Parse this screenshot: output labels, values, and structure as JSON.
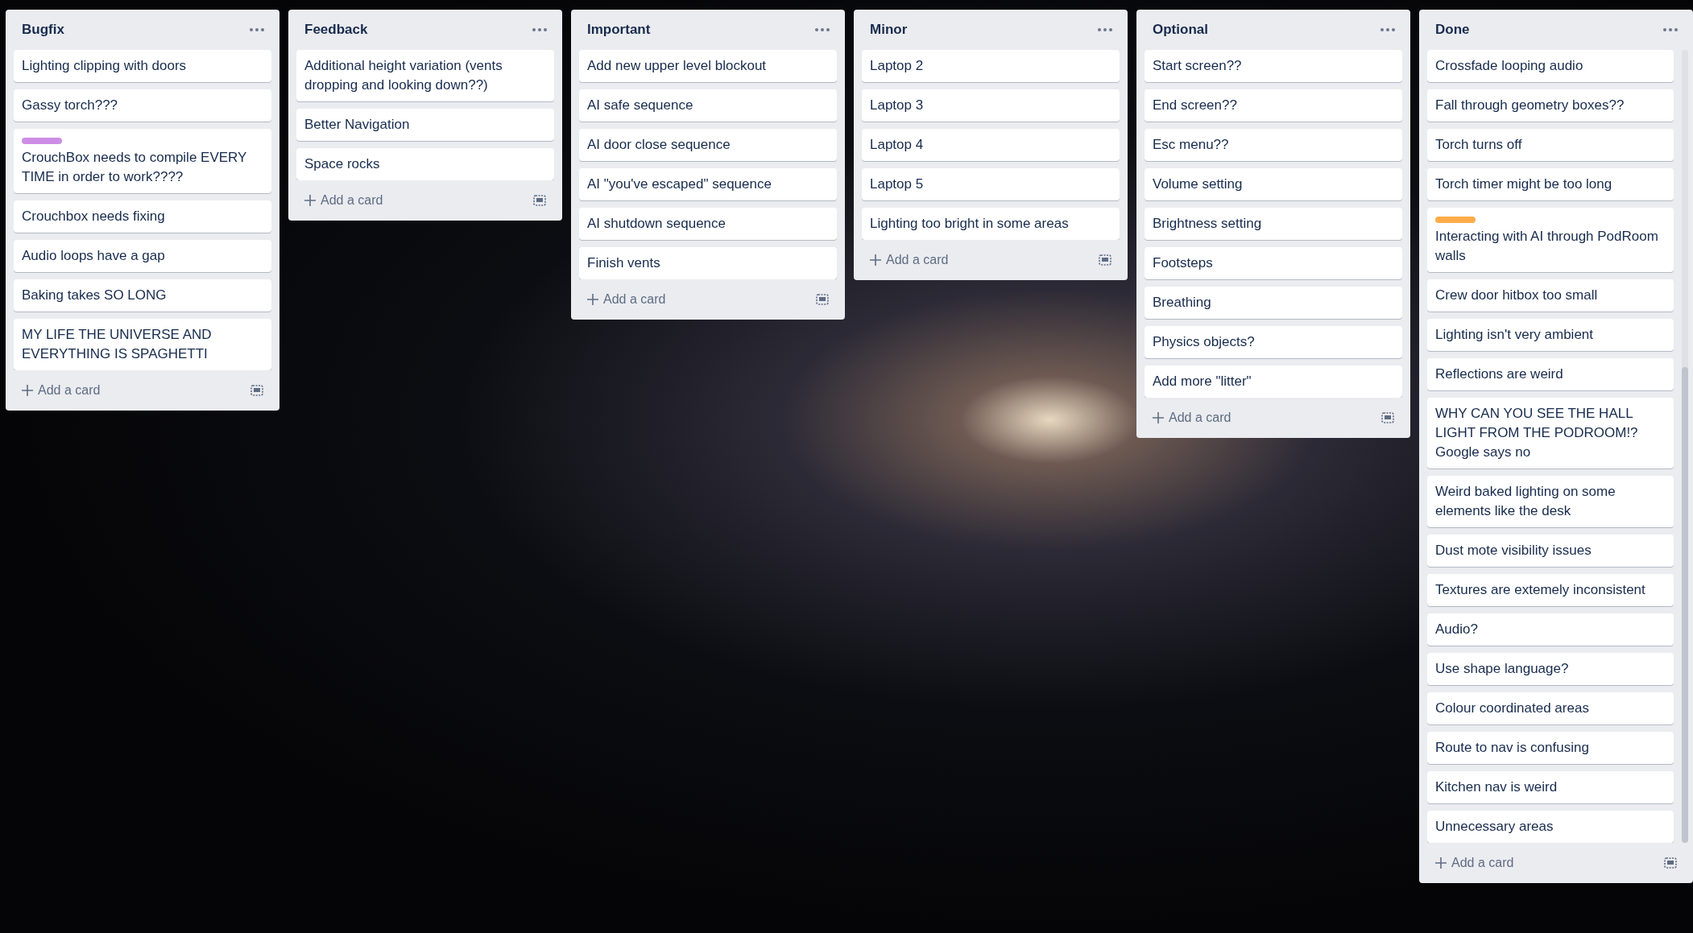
{
  "lists": [
    {
      "title": "Bugfix",
      "scrollable": false,
      "add_card": "Add a card",
      "cards": [
        {
          "text": "Lighting clipping with doors"
        },
        {
          "text": "Gassy torch???"
        },
        {
          "text": "CrouchBox needs to compile EVERY TIME in order to work????",
          "label": {
            "color": "#cd8de5"
          }
        },
        {
          "text": "Crouchbox needs fixing"
        },
        {
          "text": "Audio loops have a gap"
        },
        {
          "text": "Baking takes SO LONG"
        },
        {
          "text": "MY LIFE THE UNIVERSE AND EVERYTHING IS SPAGHETTI"
        }
      ]
    },
    {
      "title": "Feedback",
      "scrollable": false,
      "add_card": "Add a card",
      "cards": [
        {
          "text": "Additional height variation (vents dropping and looking down??)"
        },
        {
          "text": "Better Navigation"
        },
        {
          "text": "Space rocks"
        }
      ]
    },
    {
      "title": "Important",
      "scrollable": false,
      "add_card": "Add a card",
      "cards": [
        {
          "text": "Add new upper level blockout"
        },
        {
          "text": "AI safe sequence"
        },
        {
          "text": "AI door close sequence"
        },
        {
          "text": "AI \"you've escaped\" sequence"
        },
        {
          "text": "AI shutdown sequence"
        },
        {
          "text": "Finish vents"
        }
      ]
    },
    {
      "title": "Minor",
      "scrollable": false,
      "add_card": "Add a card",
      "cards": [
        {
          "text": "Laptop 2"
        },
        {
          "text": "Laptop 3"
        },
        {
          "text": "Laptop 4"
        },
        {
          "text": "Laptop 5"
        },
        {
          "text": "Lighting too bright in some areas"
        }
      ]
    },
    {
      "title": "Optional",
      "scrollable": false,
      "add_card": "Add a card",
      "cards": [
        {
          "text": "Start screen??"
        },
        {
          "text": "End screen??"
        },
        {
          "text": "Esc menu??"
        },
        {
          "text": "Volume setting"
        },
        {
          "text": "Brightness setting"
        },
        {
          "text": "Footsteps"
        },
        {
          "text": "Breathing"
        },
        {
          "text": "Physics objects?"
        },
        {
          "text": "Add more \"litter\""
        }
      ]
    },
    {
      "title": "Done",
      "scrollable": true,
      "add_card": "Add a card",
      "cards": [
        {
          "text": "Crossfade looping audio"
        },
        {
          "text": "Fall through geometry boxes??"
        },
        {
          "text": "Torch turns off"
        },
        {
          "text": "Torch timer might be too long"
        },
        {
          "text": "Interacting with AI through PodRoom walls",
          "label": {
            "color": "#ffab4a"
          }
        },
        {
          "text": "Crew door hitbox too small"
        },
        {
          "text": "Lighting isn't very ambient"
        },
        {
          "text": "Reflections are weird"
        },
        {
          "text": "WHY CAN YOU SEE THE HALL LIGHT FROM THE PODROOM!? Google says no"
        },
        {
          "text": "Weird baked lighting on some elements like the desk"
        },
        {
          "text": "Dust mote visibility issues"
        },
        {
          "text": "Textures are extemely inconsistent"
        },
        {
          "text": "Audio?"
        },
        {
          "text": "Use shape language?"
        },
        {
          "text": "Colour coordinated areas"
        },
        {
          "text": "Route to nav is confusing"
        },
        {
          "text": "Kitchen nav is weird"
        },
        {
          "text": "Unnecessary areas"
        }
      ]
    }
  ]
}
